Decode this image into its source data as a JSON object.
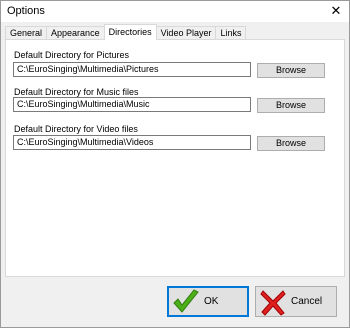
{
  "window": {
    "title": "Options",
    "close_glyph": "✕"
  },
  "tabs": [
    {
      "label": "General",
      "active": false
    },
    {
      "label": "Appearance",
      "active": false
    },
    {
      "label": "Directories",
      "active": true
    },
    {
      "label": "Video Player",
      "active": false
    },
    {
      "label": "Links",
      "active": false
    }
  ],
  "directories": {
    "pictures": {
      "label": "Default Directory for Pictures",
      "value": "C:\\EuroSinging\\Multimedia\\Pictures",
      "browse_label": "Browse"
    },
    "music": {
      "label": "Default Directory for Music files",
      "value": "C:\\EuroSinging\\Multimedia\\Music",
      "browse_label": "Browse"
    },
    "videos": {
      "label": "Default Directory for Video files",
      "value": "C:\\EuroSinging\\Multimedia\\Videos",
      "browse_label": "Browse"
    }
  },
  "buttons": {
    "ok_label": "OK",
    "ok_icon": "green-checkmark-icon",
    "cancel_label": "Cancel",
    "cancel_icon": "red-x-icon"
  },
  "colors": {
    "accent": "#0078d7",
    "ok_icon": "#4caf1a",
    "cancel_icon": "#e02020"
  }
}
